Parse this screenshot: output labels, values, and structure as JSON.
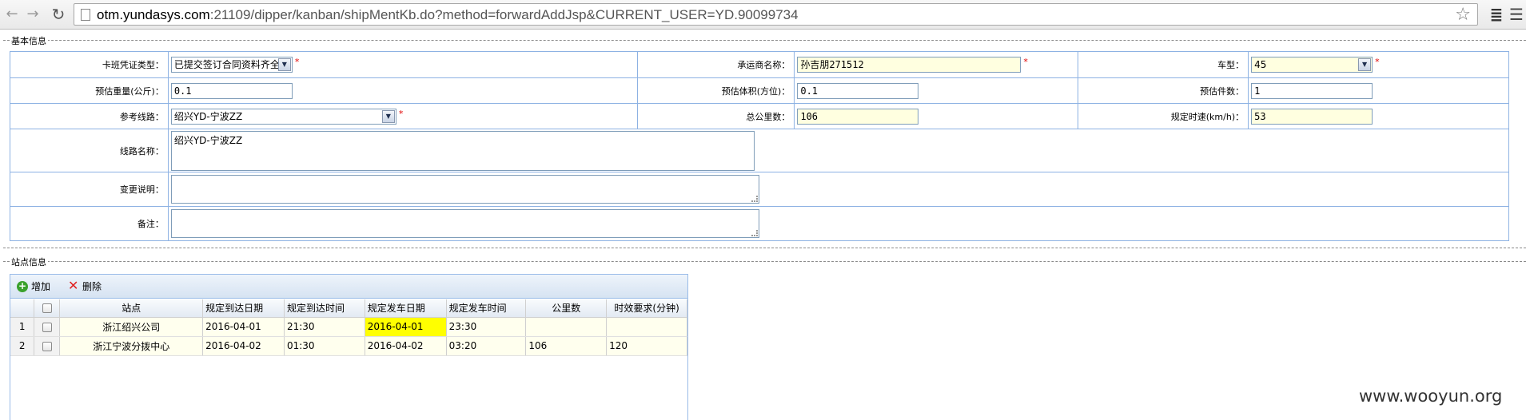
{
  "browser": {
    "url_host": "otm.yundasys.com",
    "url_rest": ":21109/dipper/kanban/shipMentKb.do?method=forwardAddJsp&CURRENT_USER=YD.90099734"
  },
  "basic_info": {
    "legend": "基本信息",
    "voucher_type": {
      "label": "卡班凭证类型：",
      "value": "已提交签订合同资料齐全"
    },
    "carrier_name": {
      "label": "承运商名称：",
      "value": "孙吉朋271512"
    },
    "vehicle_type": {
      "label": "车型：",
      "value": "45"
    },
    "est_weight": {
      "label": "预估重量(公斤)：",
      "value": "0.1"
    },
    "est_volume": {
      "label": "预估体积(方位)：",
      "value": "0.1"
    },
    "est_pieces": {
      "label": "预估件数：",
      "value": "1"
    },
    "ref_route": {
      "label": "参考线路：",
      "value": "绍兴YD-宁波ZZ"
    },
    "total_km": {
      "label": "总公里数：",
      "value": "106"
    },
    "speed": {
      "label": "规定时速(km/h)：",
      "value": "53"
    },
    "route_name": {
      "label": "线路名称：",
      "value": "绍兴YD-宁波ZZ"
    },
    "change_note": {
      "label": "变更说明：",
      "value": ""
    },
    "remark": {
      "label": "备注：",
      "value": ""
    },
    "required_mark": "*"
  },
  "station_info": {
    "legend": "站点信息",
    "toolbar": {
      "add_label": "增加",
      "delete_label": "删除"
    },
    "columns": [
      "站点",
      "规定到达日期",
      "规定到达时间",
      "规定发车日期",
      "规定发车时间",
      "公里数",
      "时效要求(分钟)"
    ],
    "rows": [
      {
        "no": "1",
        "station": "浙江绍兴公司",
        "arrive_date": "2016-04-01",
        "arrive_time": "21:30",
        "depart_date": "2016-04-01",
        "depart_time": "23:30",
        "km": "",
        "limit": ""
      },
      {
        "no": "2",
        "station": "浙江宁波分拨中心",
        "arrive_date": "2016-04-02",
        "arrive_time": "01:30",
        "depart_date": "2016-04-02",
        "depart_time": "03:20",
        "km": "106",
        "limit": "120"
      }
    ]
  },
  "watermark": "www.wooyun.org"
}
